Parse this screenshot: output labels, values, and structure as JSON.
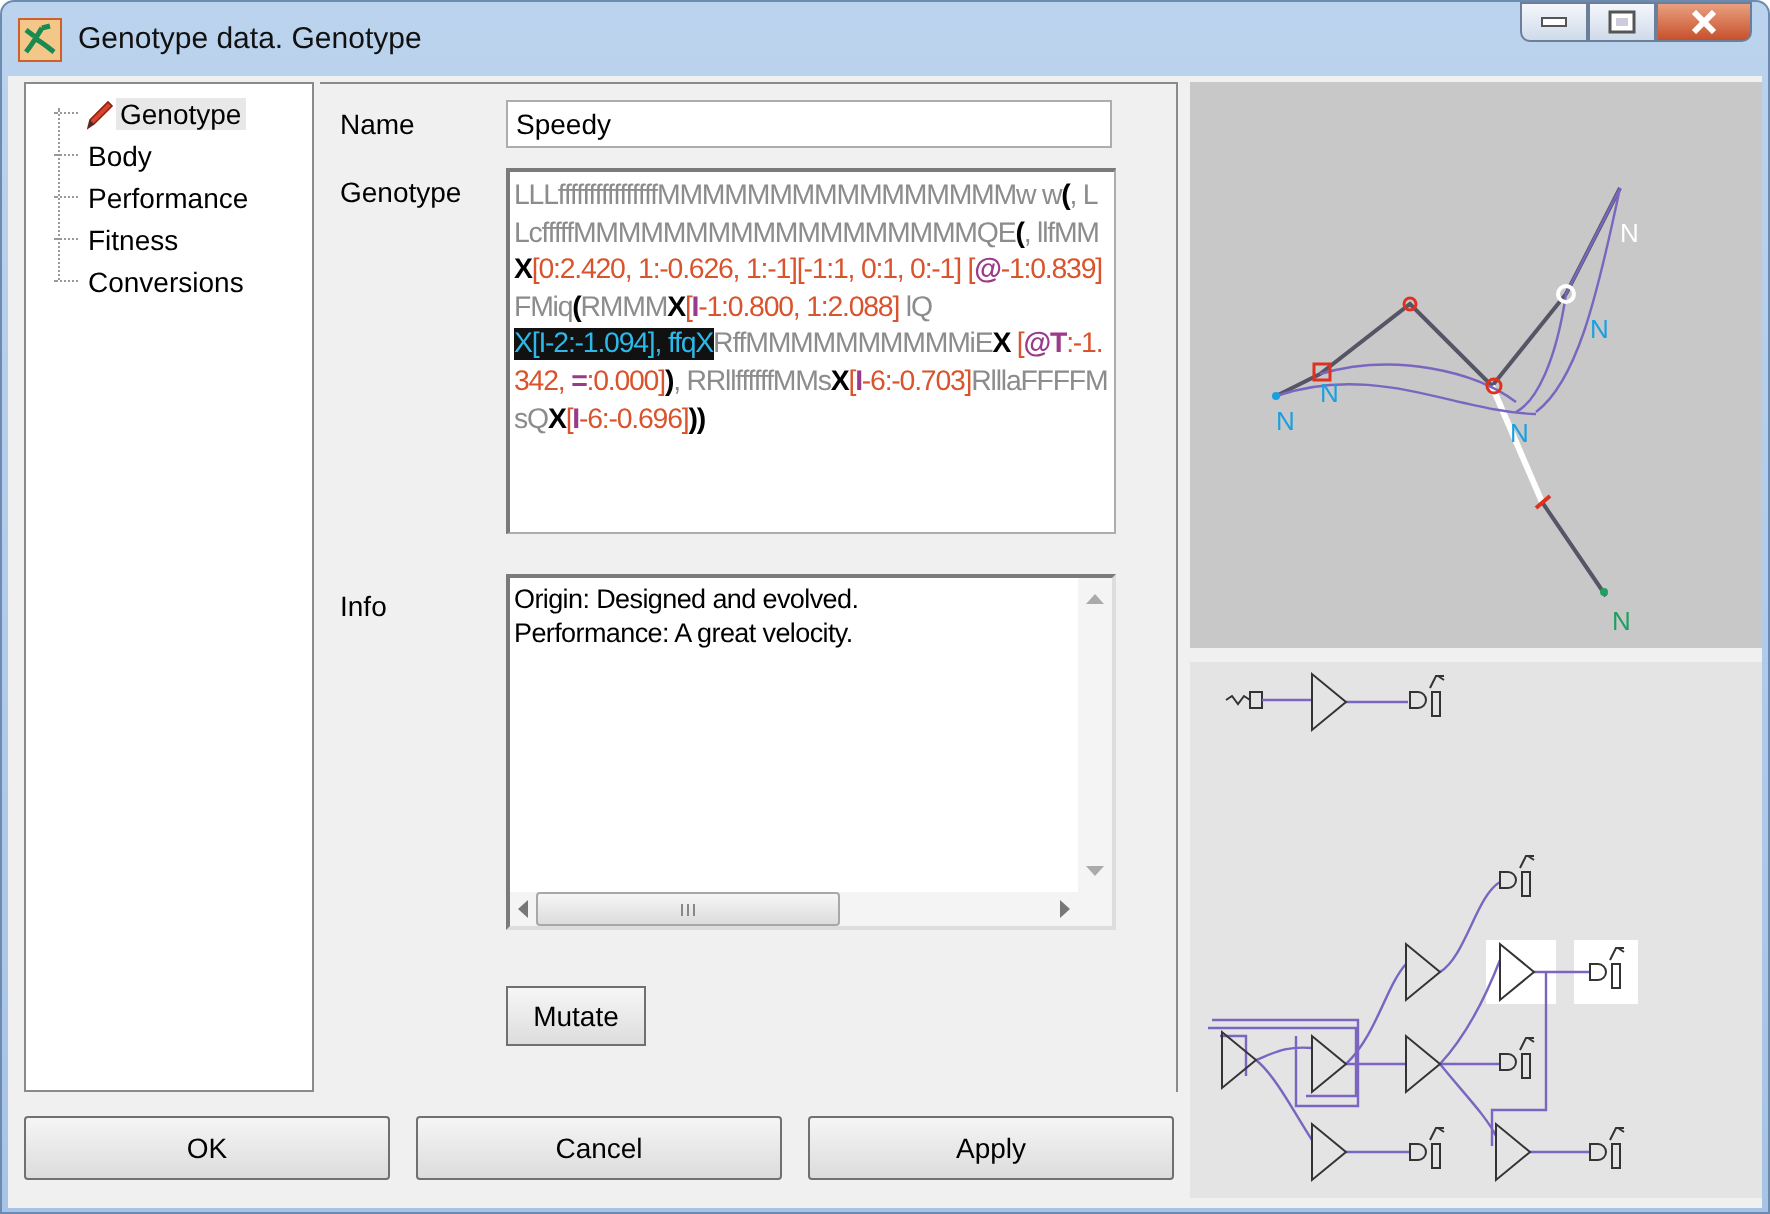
{
  "window": {
    "title": "Genotype data. Genotype"
  },
  "tree": {
    "items": [
      {
        "label": "Genotype",
        "selected": true,
        "kind": "edit"
      },
      {
        "label": "Body",
        "selected": false,
        "kind": "plain"
      },
      {
        "label": "Performance",
        "selected": false,
        "kind": "plain"
      },
      {
        "label": "Fitness",
        "selected": false,
        "kind": "plain"
      },
      {
        "label": "Conversions",
        "selected": false,
        "kind": "plain"
      }
    ]
  },
  "form": {
    "name_label": "Name",
    "name_value": "Speedy",
    "genotype_label": "Genotype",
    "genotype": [
      {
        "kind": "part",
        "text": "LLLffffffffffffffffMMMMMMMMMMMMMMMMw w"
      },
      {
        "kind": "bracket",
        "text": "("
      },
      {
        "kind": "part",
        "text": ", LLcfffffMMMMMMMMMMMMMMMMMMQE"
      },
      {
        "kind": "bracket",
        "text": "("
      },
      {
        "kind": "part",
        "text": ", llfMM"
      },
      {
        "kind": "cross",
        "text": "X"
      },
      {
        "kind": "param",
        "text": "[0:2.420, 1:-0.626, 1:-1][-1:1, 0:1, 0:-1] ["
      },
      {
        "kind": "mark",
        "text": "@"
      },
      {
        "kind": "param",
        "text": "-1:0.839]"
      },
      {
        "kind": "part",
        "text": "FMiq"
      },
      {
        "kind": "bracket",
        "text": "("
      },
      {
        "kind": "part",
        "text": "RMMM"
      },
      {
        "kind": "cross",
        "text": "X"
      },
      {
        "kind": "param",
        "text": "["
      },
      {
        "kind": "mark",
        "text": "I"
      },
      {
        "kind": "param",
        "text": "-1:0.800, 1:2.088] "
      },
      {
        "kind": "part",
        "text": "lQ"
      },
      {
        "kind": "selected",
        "text": "X[I-2:-1.094], ffqX"
      },
      {
        "kind": "part",
        "text": "RffMMMMMMMMMMiE"
      },
      {
        "kind": "cross",
        "text": "X"
      },
      {
        "kind": "param",
        "text": " ["
      },
      {
        "kind": "mark",
        "text": "@T"
      },
      {
        "kind": "param",
        "text": ":-1.342, "
      },
      {
        "kind": "mark",
        "text": "="
      },
      {
        "kind": "param",
        "text": ":0.000]"
      },
      {
        "kind": "bracket",
        "text": ")"
      },
      {
        "kind": "part",
        "text": ", RRllffffffMMs"
      },
      {
        "kind": "cross",
        "text": "X"
      },
      {
        "kind": "param",
        "text": "["
      },
      {
        "kind": "mark",
        "text": "I"
      },
      {
        "kind": "param",
        "text": "-6:-0.703]"
      },
      {
        "kind": "part",
        "text": "RlllaFFFFMsQ"
      },
      {
        "kind": "cross",
        "text": "X"
      },
      {
        "kind": "param",
        "text": "["
      },
      {
        "kind": "mark",
        "text": "I"
      },
      {
        "kind": "param",
        "text": "-6:-0.696]"
      },
      {
        "kind": "bracket",
        "text": "))"
      }
    ],
    "info_label": "Info",
    "info": "Origin: Designed and evolved.\nPerformance: A great velocity.",
    "mutate_button": "Mutate"
  },
  "body_view": {
    "labels": [
      {
        "text": "N",
        "color": "#1aa0e0"
      },
      {
        "text": "N",
        "color": "#1aa0e0"
      },
      {
        "text": "N",
        "color": "#1aa0e0"
      },
      {
        "text": "N",
        "color": "#1aa0e0"
      },
      {
        "text": "N",
        "color": "#ffffff"
      },
      {
        "text": "N",
        "color": "#20a060"
      }
    ]
  },
  "buttons": [
    "OK",
    "Cancel",
    "Apply"
  ]
}
